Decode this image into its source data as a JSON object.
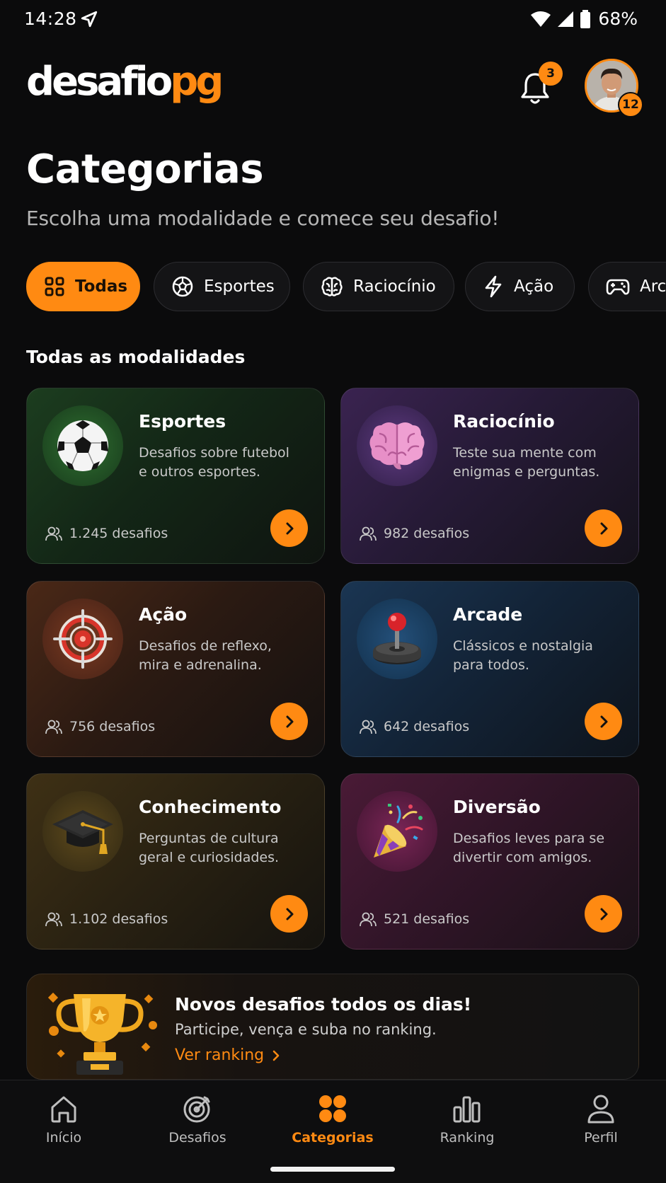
{
  "status_bar": {
    "time": "14:28",
    "battery": "68%"
  },
  "header": {
    "logo_part1": "desafio",
    "logo_part2": "pg",
    "notification_count": "3",
    "user_level": "12"
  },
  "page": {
    "title": "Categorias",
    "subtitle": "Escolha uma modalidade e comece seu desafio!"
  },
  "filters": [
    {
      "label": "Todas",
      "icon": "grid-icon",
      "active": true
    },
    {
      "label": "Esportes",
      "icon": "soccer-ball-icon"
    },
    {
      "label": "Raciocínio",
      "icon": "brain-icon"
    },
    {
      "label": "Ação",
      "icon": "lightning-icon"
    },
    {
      "label": "Arcade",
      "icon": "gamepad-icon"
    }
  ],
  "section_title": "Todas as modalidades",
  "categories": [
    {
      "title": "Esportes",
      "description": "Desafios sobre futebol e outros esportes.",
      "count": "1.245 desafios",
      "icon": "soccer-ball-icon",
      "color": "#2e7d32"
    },
    {
      "title": "Raciocínio",
      "description": "Teste sua mente com enigmas e perguntas.",
      "count": "982 desafios",
      "icon": "brain-icon",
      "color": "#7b3fa8"
    },
    {
      "title": "Ação",
      "description": "Desafios de reflexo, mira e adrenalina.",
      "count": "756 desafios",
      "icon": "target-icon",
      "color": "#c0532a"
    },
    {
      "title": "Arcade",
      "description": "Clássicos e nostalgia para todos.",
      "count": "642 desafios",
      "icon": "joystick-icon",
      "color": "#1e5a8c"
    },
    {
      "title": "Conhecimento",
      "description": "Perguntas de cultura geral e curiosidades.",
      "count": "1.102 desafios",
      "icon": "graduation-cap-icon",
      "color": "#8a6a1e"
    },
    {
      "title": "Diversão",
      "description": "Desafios leves para se divertir com amigos.",
      "count": "521 desafios",
      "icon": "party-popper-icon",
      "color": "#9a2a66"
    }
  ],
  "banner": {
    "title": "Novos desafios todos os dias!",
    "subtitle": "Participe, vença e suba no ranking.",
    "link": "Ver ranking"
  },
  "bottom_nav": [
    {
      "label": "Início",
      "icon": "home-icon"
    },
    {
      "label": "Desafios",
      "icon": "target-icon"
    },
    {
      "label": "Categorias",
      "icon": "categories-icon",
      "active": true
    },
    {
      "label": "Ranking",
      "icon": "bar-chart-icon"
    },
    {
      "label": "Perfil",
      "icon": "user-icon"
    }
  ],
  "colors": {
    "accent": "#ff8a12",
    "background": "#0b0b0c"
  }
}
